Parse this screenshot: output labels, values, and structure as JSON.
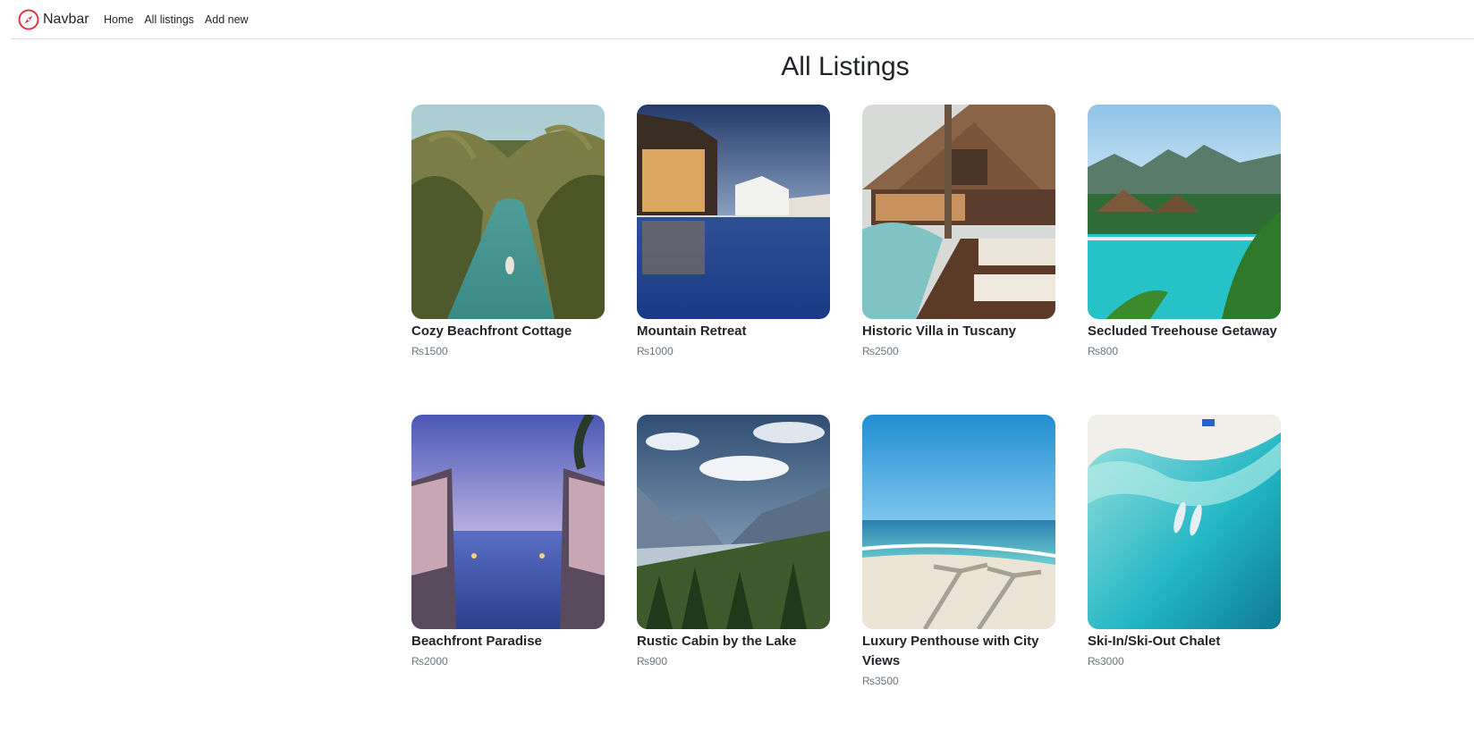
{
  "navbar": {
    "brand": "Navbar",
    "links": [
      "Home",
      "All listings",
      "Add new"
    ]
  },
  "page": {
    "title": "All Listings"
  },
  "listings": [
    {
      "title": "Cozy Beachfront Cottage",
      "price": "₨1500"
    },
    {
      "title": "Mountain Retreat",
      "price": "₨1000"
    },
    {
      "title": "Historic Villa in Tuscany",
      "price": "₨2500"
    },
    {
      "title": "Secluded Treehouse Getaway",
      "price": "₨800"
    },
    {
      "title": "Beachfront Paradise",
      "price": "₨2000"
    },
    {
      "title": "Rustic Cabin by the Lake",
      "price": "₨900"
    },
    {
      "title": "Luxury Penthouse with City Views",
      "price": "₨3500"
    },
    {
      "title": "Ski-In/Ski-Out Chalet",
      "price": "₨3000"
    }
  ],
  "colors": {
    "brand_icon": "#e3343f",
    "navbar_border": "#dee2e6",
    "price_text": "#6c757d"
  }
}
